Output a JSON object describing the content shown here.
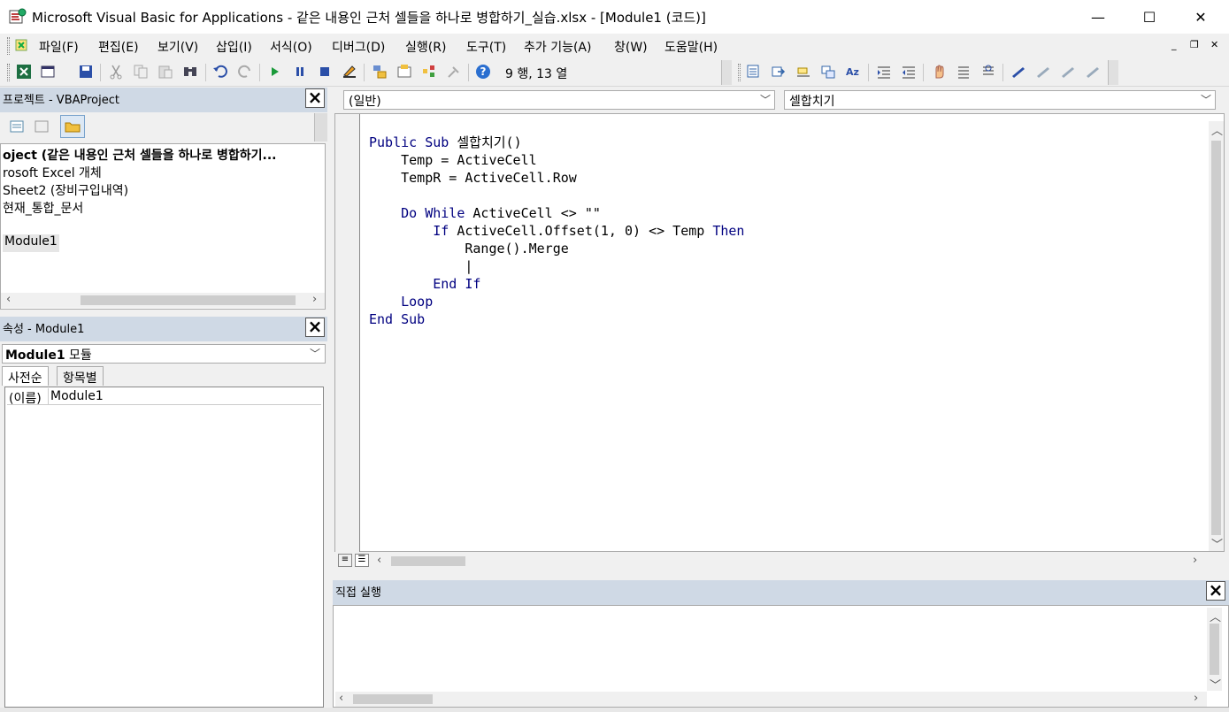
{
  "window": {
    "title": "Microsoft Visual Basic for Applications - 같은 내용인 근처 셀들을 하나로 병합하기_실습.xlsx - [Module1 (코드)]",
    "minimize": "—",
    "maximize": "☐",
    "close": "✕"
  },
  "menu": {
    "items": [
      "파일(F)",
      "편집(E)",
      "보기(V)",
      "삽입(I)",
      "서식(O)",
      "디버그(D)",
      "실행(R)",
      "도구(T)",
      "추가 기능(A)",
      "창(W)",
      "도움말(H)"
    ],
    "mdi_min": "_",
    "mdi_restore": "❐",
    "mdi_close": "✕"
  },
  "toolbar": {
    "position": "9 행, 13 열"
  },
  "project": {
    "title": "프로젝트 - VBAProject",
    "tree": [
      "oject (같은 내용인 근처 셀들을 하나로 병합하기...",
      "rosoft Excel 개체",
      "Sheet2 (장비구입내역)",
      "현재_통합_문서",
      "",
      "Module1"
    ]
  },
  "properties": {
    "title": "속성 - Module1",
    "object_name": "Module1",
    "object_type": "모듈",
    "tab_alpha": "사전순",
    "tab_category": "항목별",
    "rows": [
      {
        "name": "(이름)",
        "value": "Module1"
      }
    ]
  },
  "code": {
    "object_combo": "(일반)",
    "proc_combo": "셀합치기",
    "lines": [
      {
        "segments": [
          {
            "t": "Public Sub ",
            "k": true
          },
          {
            "t": "셀합치기()",
            "k": false
          }
        ]
      },
      {
        "segments": [
          {
            "t": "    Temp = ActiveCell",
            "k": false
          }
        ]
      },
      {
        "segments": [
          {
            "t": "    TempR = ActiveCell.Row",
            "k": false
          }
        ]
      },
      {
        "segments": [
          {
            "t": "",
            "k": false
          }
        ]
      },
      {
        "segments": [
          {
            "t": "    ",
            "k": false
          },
          {
            "t": "Do While",
            "k": true
          },
          {
            "t": " ActiveCell <> \"\"",
            "k": false
          }
        ]
      },
      {
        "segments": [
          {
            "t": "        ",
            "k": false
          },
          {
            "t": "If",
            "k": true
          },
          {
            "t": " ActiveCell.Offset(1, 0) <> Temp ",
            "k": false
          },
          {
            "t": "Then",
            "k": true
          }
        ]
      },
      {
        "segments": [
          {
            "t": "            Range().Merge",
            "k": false
          }
        ]
      },
      {
        "segments": [
          {
            "t": "            |",
            "k": false
          }
        ]
      },
      {
        "segments": [
          {
            "t": "        ",
            "k": false
          },
          {
            "t": "End If",
            "k": true
          }
        ]
      },
      {
        "segments": [
          {
            "t": "    ",
            "k": false
          },
          {
            "t": "Loop",
            "k": true
          }
        ]
      },
      {
        "segments": [
          {
            "t": "End Sub",
            "k": true
          }
        ]
      }
    ]
  },
  "immediate": {
    "title": "직접 실행"
  },
  "colors": {
    "keyword": "#000080",
    "panel_title_bg": "#cfd9e5"
  }
}
